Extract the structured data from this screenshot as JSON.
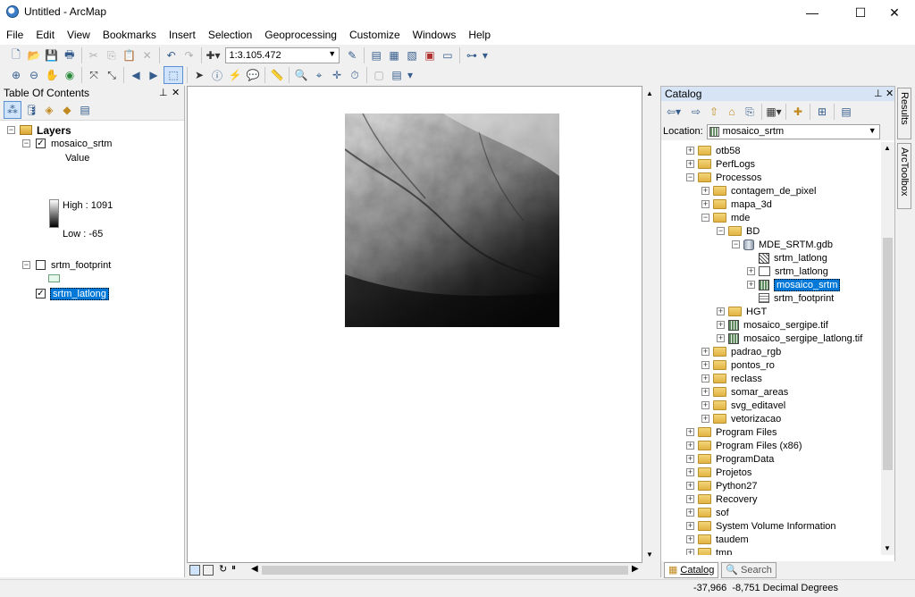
{
  "window": {
    "title": "Untitled - ArcMap",
    "minimize": "—",
    "maximize": "☐",
    "close": "✕"
  },
  "menu": [
    "File",
    "Edit",
    "View",
    "Bookmarks",
    "Insert",
    "Selection",
    "Geoprocessing",
    "Customize",
    "Windows",
    "Help"
  ],
  "toolbar": {
    "scale": "1:3.105.472"
  },
  "toc": {
    "title": "Table Of Contents",
    "layers_label": "Layers",
    "layer1": {
      "name": "mosaico_srtm",
      "checked": true,
      "legend_title": "Value",
      "high": "High : 1091",
      "low": "Low : -65"
    },
    "layer2": {
      "name": "srtm_footprint",
      "checked": false
    },
    "layer3": {
      "name": "srtm_latlong",
      "checked": true
    }
  },
  "catalog": {
    "title": "Catalog",
    "location_label": "Location:",
    "location_value": "mosaico_srtm",
    "items": [
      {
        "label": "otb58",
        "indent": 1,
        "exp": "+",
        "icon": "folder"
      },
      {
        "label": "PerfLogs",
        "indent": 1,
        "exp": "+",
        "icon": "folder"
      },
      {
        "label": "Processos",
        "indent": 1,
        "exp": "−",
        "icon": "folder"
      },
      {
        "label": "contagem_de_pixel",
        "indent": 2,
        "exp": "+",
        "icon": "folder"
      },
      {
        "label": "mapa_3d",
        "indent": 2,
        "exp": "+",
        "icon": "folder"
      },
      {
        "label": "mde",
        "indent": 2,
        "exp": "−",
        "icon": "folder"
      },
      {
        "label": "BD",
        "indent": 3,
        "exp": "−",
        "icon": "folder"
      },
      {
        "label": "MDE_SRTM.gdb",
        "indent": 4,
        "exp": "−",
        "icon": "gdb"
      },
      {
        "label": "srtm_latlong",
        "indent": 5,
        "exp": "",
        "icon": "raster"
      },
      {
        "label": "srtm_latlong",
        "indent": 5,
        "exp": "+",
        "icon": "dataset"
      },
      {
        "label": "mosaico_srtm",
        "indent": 5,
        "exp": "+",
        "icon": "mosaic",
        "selected": true
      },
      {
        "label": "srtm_footprint",
        "indent": 5,
        "exp": "",
        "icon": "table"
      },
      {
        "label": "HGT",
        "indent": 3,
        "exp": "+",
        "icon": "folder"
      },
      {
        "label": "mosaico_sergipe.tif",
        "indent": 3,
        "exp": "+",
        "icon": "mosaic"
      },
      {
        "label": "mosaico_sergipe_latlong.tif",
        "indent": 3,
        "exp": "+",
        "icon": "mosaic"
      },
      {
        "label": "padrao_rgb",
        "indent": 2,
        "exp": "+",
        "icon": "folder"
      },
      {
        "label": "pontos_ro",
        "indent": 2,
        "exp": "+",
        "icon": "folder"
      },
      {
        "label": "reclass",
        "indent": 2,
        "exp": "+",
        "icon": "folder"
      },
      {
        "label": "somar_areas",
        "indent": 2,
        "exp": "+",
        "icon": "folder"
      },
      {
        "label": "svg_editavel",
        "indent": 2,
        "exp": "+",
        "icon": "folder"
      },
      {
        "label": "vetorizacao",
        "indent": 2,
        "exp": "+",
        "icon": "folder"
      },
      {
        "label": "Program Files",
        "indent": 1,
        "exp": "+",
        "icon": "folder"
      },
      {
        "label": "Program Files (x86)",
        "indent": 1,
        "exp": "+",
        "icon": "folder"
      },
      {
        "label": "ProgramData",
        "indent": 1,
        "exp": "+",
        "icon": "folder"
      },
      {
        "label": "Projetos",
        "indent": 1,
        "exp": "+",
        "icon": "folder"
      },
      {
        "label": "Python27",
        "indent": 1,
        "exp": "+",
        "icon": "folder"
      },
      {
        "label": "Recovery",
        "indent": 1,
        "exp": "+",
        "icon": "folder"
      },
      {
        "label": "sof",
        "indent": 1,
        "exp": "+",
        "icon": "folder"
      },
      {
        "label": "System Volume Information",
        "indent": 1,
        "exp": "+",
        "icon": "folder"
      },
      {
        "label": "taudem",
        "indent": 1,
        "exp": "+",
        "icon": "folder"
      },
      {
        "label": "tmp",
        "indent": 1,
        "exp": "+",
        "icon": "folder"
      }
    ],
    "tabs": {
      "catalog": "Catalog",
      "search": "Search"
    }
  },
  "side_tabs": {
    "results": "Results",
    "toolbox": "ArcToolbox"
  },
  "status": {
    "coords": "-37,966  -8,751 Decimal Degrees"
  }
}
